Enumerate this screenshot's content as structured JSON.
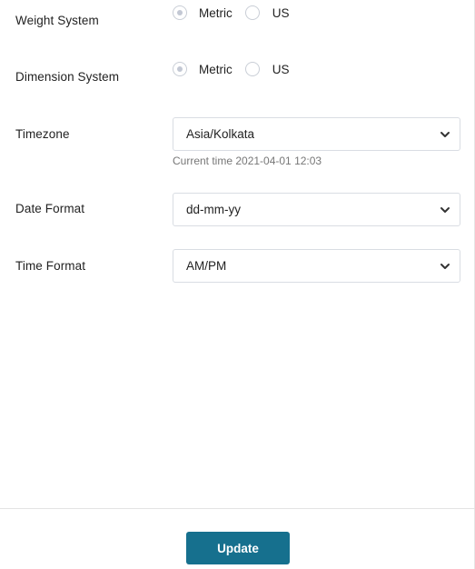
{
  "weight_system": {
    "label": "Weight System",
    "options": [
      {
        "label": "Metric",
        "selected": true
      },
      {
        "label": "US",
        "selected": false
      }
    ]
  },
  "dimension_system": {
    "label": "Dimension System",
    "options": [
      {
        "label": "Metric",
        "selected": true
      },
      {
        "label": "US",
        "selected": false
      }
    ]
  },
  "timezone": {
    "label": "Timezone",
    "value": "Asia/Kolkata",
    "helper": "Current time 2021-04-01 12:03"
  },
  "date_format": {
    "label": "Date Format",
    "value": "dd-mm-yy"
  },
  "time_format": {
    "label": "Time Format",
    "value": "AM/PM"
  },
  "footer": {
    "update_label": "Update"
  },
  "colors": {
    "button_bg": "#16708e",
    "radio_dot": "#c3c8d4",
    "border": "#d9dde3"
  },
  "icons": {
    "select_arrow": "chevron-down-icon",
    "radio": "radio-button-icon"
  }
}
